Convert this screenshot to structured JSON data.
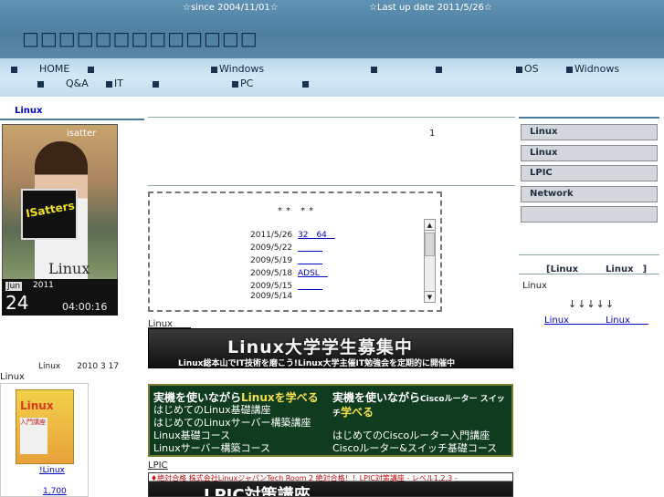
{
  "header": {
    "since": "☆since 2004/11/01☆",
    "last_update": "☆Last up date 2011/5/26☆",
    "site_title": "□□□□□□□□□□□□□"
  },
  "nav": {
    "row1": [
      "HOME",
      "",
      "Windows",
      "",
      "",
      "OS",
      "Widnows"
    ],
    "row2": [
      "",
      "Q&A",
      "IT",
      "",
      "PC",
      ""
    ]
  },
  "left": {
    "heading": "Linux",
    "photo_brand": "isatter",
    "photo_sign": "ISatters",
    "photo_linux": "Linux",
    "clock": {
      "month": "Jun",
      "day": "24",
      "year": "2011",
      "time": "04:00:16"
    },
    "date_text": "Linux　　2010 3 17",
    "linux_label": "Linux",
    "book": {
      "cover_title": "Linux",
      "cover_sub": "入門講座",
      "link": "!Linux",
      "price": "1,700"
    }
  },
  "center": {
    "count": "1",
    "news_stars": "** **",
    "news": [
      {
        "date": "2011/5/26",
        "title": "32　64　"
      },
      {
        "date": "2009/5/22",
        "title": "　　　"
      },
      {
        "date": "2009/5/19",
        "title": "　　　"
      },
      {
        "date": "2009/5/18",
        "title": "ADSL　"
      },
      {
        "date": "2009/5/15",
        "title": "　　　"
      },
      {
        "date": "2009/5/14",
        "title": ""
      }
    ],
    "scroll_up": "▲",
    "scroll_down": "▼",
    "linux_heading": "Linux　　",
    "banner1": {
      "title": "Linux大学学生募集中",
      "sub": "Linux総本山でIT技術を磨こう!Linux大学主催IT勉強会を定期的に開催中"
    },
    "dash_link": "　",
    "banner2": {
      "left_head_a": "実機を使いながら",
      "left_head_b": "Linuxを",
      "left_head_c": "学べる",
      "left_lines": [
        "はじめてのLinux基礎講座",
        "はじめてのLinuxサーバー構築講座",
        "Linux基礎コース",
        "Linuxサーバー構築コース"
      ],
      "right_head_a": "実機を使いながら",
      "right_head_b": "Ciscoルーター スイッチ",
      "right_head_c": "学べる",
      "right_lines": [
        "はじめてのCiscoルーター入門講座",
        "Ciscoルーター&スイッチ基礎コース"
      ]
    },
    "lpic_label": "LPIC",
    "banner3": {
      "top": "♦絶対合格 株式会社LinuxジャパンTech Room 2 絶対合格！！LPIC対策講座 - レベル1,2,3 -",
      "main": "LPIC対策講座"
    }
  },
  "right": {
    "buttons": [
      "Linux",
      "Linux",
      "LPIC",
      "Network",
      ""
    ],
    "linux_title": "[Linux　　　Linux　]",
    "linux_label": "Linux",
    "arrows": "↓↓↓↓↓",
    "links": "Linux　　　　Linux　　"
  }
}
